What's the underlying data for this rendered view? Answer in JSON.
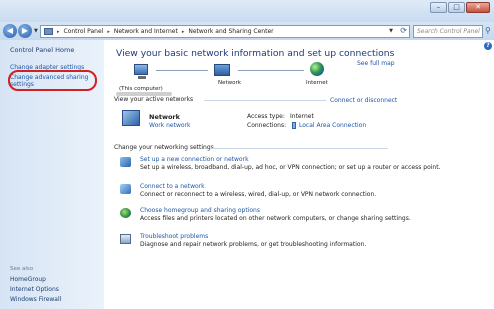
{
  "window": {
    "minimize_glyph": "–",
    "maximize_glyph": "□",
    "close_glyph": "✕"
  },
  "address_bar": {
    "crumbs": [
      "Control Panel",
      "Network and Internet",
      "Network and Sharing Center"
    ],
    "separator": "▸",
    "search_placeholder": "Search Control Panel",
    "back_glyph": "◀",
    "forward_glyph": "▶"
  },
  "sidebar": {
    "home": "Control Panel Home",
    "links": [
      "Change adapter settings",
      "Change advanced sharing",
      "settings"
    ],
    "see_also_label": "See also",
    "see_also_links": [
      "HomeGroup",
      "Internet Options",
      "Windows Firewall"
    ]
  },
  "main": {
    "help_glyph": "?",
    "heading": "View your basic network information and set up connections",
    "see_full_map": "See full map",
    "map": {
      "computer_label": "(This computer)",
      "network_label": "Network",
      "internet_label": "Internet"
    },
    "active_networks_label": "View your active networks",
    "connect_disconnect": "Connect or disconnect",
    "network": {
      "name": "Network",
      "type": "Work network",
      "access_type_label": "Access type:",
      "access_type_value": "Internet",
      "connections_label": "Connections:",
      "connections_value": "Local Area Connection"
    },
    "change_settings_label": "Change your networking settings",
    "tasks": [
      {
        "icon": "network-setup-icon",
        "title": "Set up a new connection or network",
        "desc": "Set up a wireless, broadband, dial-up, ad hoc, or VPN connection; or set up a router or access point."
      },
      {
        "icon": "connect-network-icon",
        "title": "Connect to a network",
        "desc": "Connect or reconnect to a wireless, wired, dial-up, or VPN network connection."
      },
      {
        "icon": "homegroup-icon",
        "title": "Choose homegroup and sharing options",
        "desc": "Access files and printers located on other network computers, or change sharing settings."
      },
      {
        "icon": "troubleshoot-icon",
        "title": "Troubleshoot problems",
        "desc": "Diagnose and repair network problems, or get troubleshooting information."
      }
    ]
  }
}
